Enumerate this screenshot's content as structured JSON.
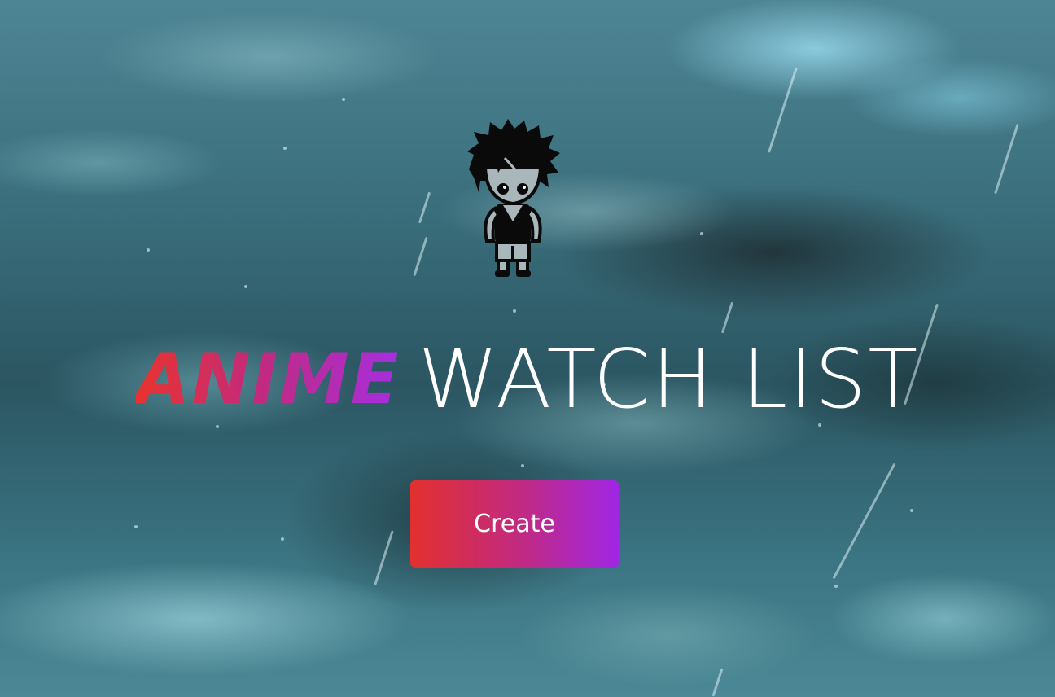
{
  "hero": {
    "title_accent": "ANIME",
    "title_main": "WATCH LIST",
    "create_label": "Create"
  },
  "icons": {
    "mascot": "anime-character-icon"
  },
  "colors": {
    "gradient_start": "#e2302f",
    "gradient_mid": "#c02a85",
    "gradient_end": "#a026e4",
    "title_text": "#ffffff"
  }
}
